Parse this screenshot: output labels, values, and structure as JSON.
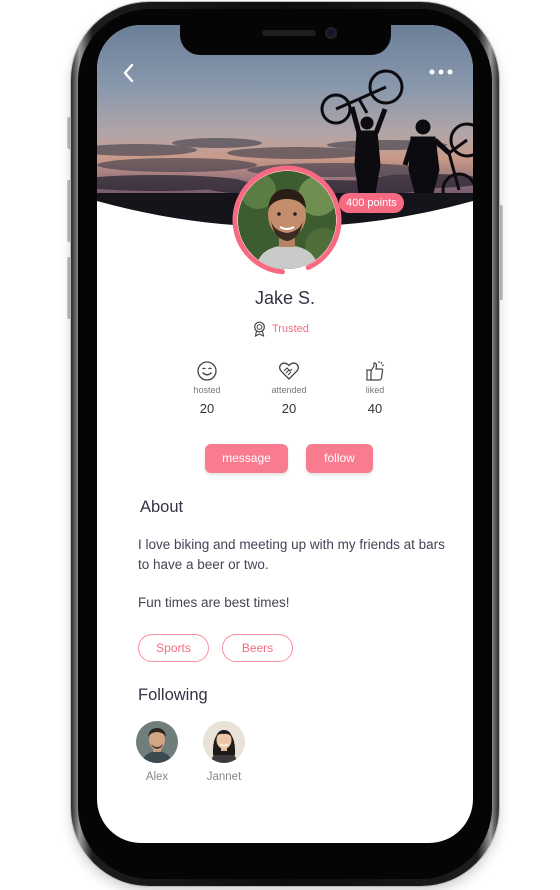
{
  "profile": {
    "name": "Jake S.",
    "points_badge": "400 points",
    "status_label": "Trusted"
  },
  "stats": [
    {
      "label": "hosted",
      "value": "20",
      "icon": "smile-icon"
    },
    {
      "label": "attended",
      "value": "20",
      "icon": "handshake-heart-icon"
    },
    {
      "label": "liked",
      "value": "40",
      "icon": "thumbs-up-icon"
    }
  ],
  "actions": {
    "message_label": "message",
    "follow_label": "follow"
  },
  "about": {
    "title": "About",
    "paragraphs": [
      "I love biking and meeting up with my friends at bars to have a beer or two.",
      "Fun times are best times!"
    ]
  },
  "tags": [
    "Sports",
    "Beers"
  ],
  "following": {
    "title": "Following",
    "people": [
      {
        "name": "Alex"
      },
      {
        "name": "Jannet"
      }
    ]
  },
  "theme": {
    "accent": "#f76b82",
    "text": "#333344"
  }
}
